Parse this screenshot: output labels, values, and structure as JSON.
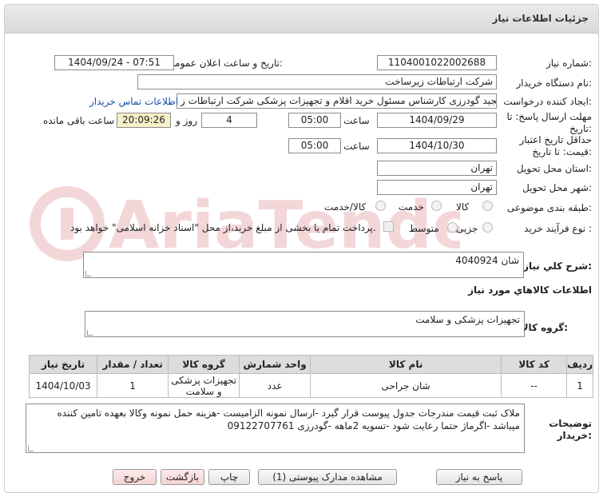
{
  "header": {
    "title": "جزئیات اطلاعات نیاز"
  },
  "labels": {
    "need_number": "شماره نیاز:",
    "announce_datetime": "تاریخ و ساعت اعلان عمومی:",
    "buyer_org": "نام دستگاه خریدار:",
    "requester": "ایجاد کننده درخواست:",
    "reply_deadline_1": "مهلت ارسال پاسخ: تا",
    "reply_deadline_2": "تاریخ:",
    "validity_1": "حداقل تاریخ اعتبار",
    "validity_2": "قیمت: تا تاریخ:",
    "time": "ساعت",
    "day_and": "روز و",
    "remaining": "ساعت باقی مانده",
    "province": "استان محل تحویل:",
    "city": "شهر محل تحویل:",
    "category": "طبقه بندی موضوعی:",
    "process": "نوع فرآیند خرید :",
    "summary": "شرح کلي نياز:",
    "goods_info": "اطلاعات كالاهاي مورد نياز",
    "goods_group": "گروه کالا:",
    "buyer_notes_1": "توضیحات",
    "buyer_notes_2": "خریدار:"
  },
  "fields": {
    "need_number": "1104001022002688",
    "announce_datetime": "1404/09/24 - 07:51",
    "buyer_org": "شرکت ارتباطات زیرساخت",
    "requester": "مجید گودرزی کارشناس مسئول خرید اقلام و تجهیزات پزشکی شرکت ارتباطات ز",
    "contact_link": "اطلاعات تماس خریدار",
    "reply_date": "1404/09/29",
    "reply_time": "05:00",
    "days": "4",
    "remaining_time": "20:09:26",
    "validity_date": "1404/10/30",
    "validity_time": "05:00",
    "province": "تهران",
    "city": "تهران",
    "summary": "شان 4040924",
    "goods_group": "تجهیزات پزشکی و سلامت",
    "buyer_notes": "ملاک ثبت قیمت مندرجات جدول پیوست قرار گیرد -ارسال نمونه الزامیست -هزینه حمل نمونه وکالا بعهده تامین کننده میباشد -اگرماژ حتما رعایت شود -تسویه 2ماهه -گودرزی 09122707761"
  },
  "category_options": [
    "کالا",
    "خدمت",
    "کالا/خدمت"
  ],
  "process_options": [
    "جزیی",
    "متوسط"
  ],
  "process_note": "پرداخت تمام یا بخشی از مبلغ خرید،از محل \"اسناد خزانه اسلامی\" خواهد بود.",
  "table": {
    "headers": [
      "ردیف",
      "کد کالا",
      "نام کالا",
      "واحد شمارش",
      "تعداد / مقدار",
      "تاریخ نیاز"
    ],
    "rows": [
      [
        "1",
        "--",
        "شان جراحی",
        "عدد",
        "1",
        "1404/10/03"
      ]
    ],
    "group_cell": "تجهیزات پزشکی و سلامت"
  },
  "buttons": {
    "reply": "پاسخ به نیاز",
    "attachments": "مشاهده مدارک پیوستی (1)",
    "print": "چاپ",
    "back": "بازگشت",
    "exit": "خروج"
  },
  "watermark": "AriaTender.net",
  "colors": {
    "link": "#1a4fa8",
    "highlight": "#f6f0c8",
    "watermark": "#c0282d"
  }
}
